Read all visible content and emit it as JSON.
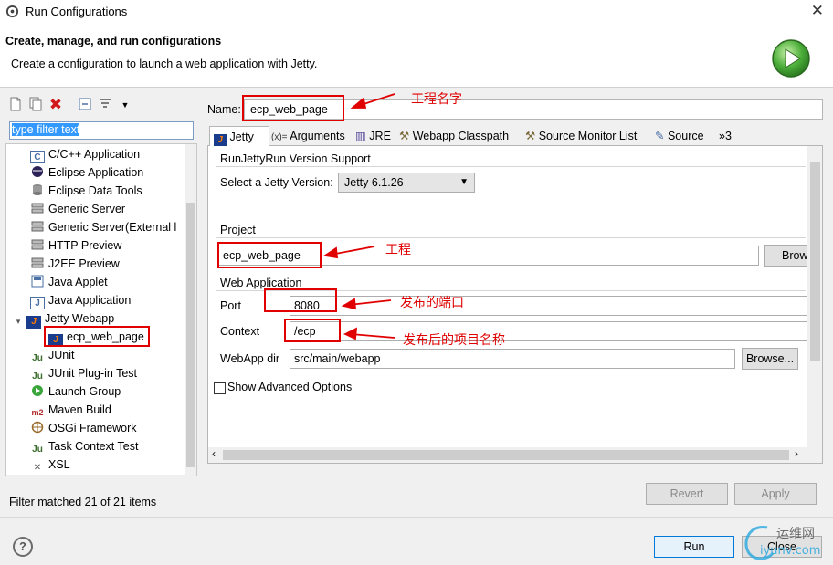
{
  "window": {
    "title": "Run Configurations",
    "close_glyph": "✕"
  },
  "header": {
    "title": "Create, manage, and run configurations",
    "subtitle": "Create a configuration to launch a web application with Jetty."
  },
  "filter": {
    "value": "type filter text"
  },
  "tree": {
    "items": [
      {
        "label": "C/C++ Application",
        "icon": "c-app-icon"
      },
      {
        "label": "Eclipse Application",
        "icon": "eclipse-icon"
      },
      {
        "label": "Eclipse Data Tools",
        "icon": "data-tools-icon"
      },
      {
        "label": "Generic Server",
        "icon": "server-icon"
      },
      {
        "label": "Generic Server(External l",
        "icon": "server-icon"
      },
      {
        "label": "HTTP Preview",
        "icon": "server-icon"
      },
      {
        "label": "J2EE Preview",
        "icon": "server-icon"
      },
      {
        "label": "Java Applet",
        "icon": "applet-icon"
      },
      {
        "label": "Java Application",
        "icon": "java-app-icon"
      },
      {
        "label": "Jetty Webapp",
        "icon": "jetty-icon"
      },
      {
        "label": "ecp_web_page",
        "icon": "jetty-icon"
      },
      {
        "label": "JUnit",
        "icon": "junit-icon"
      },
      {
        "label": "JUnit Plug-in Test",
        "icon": "junit-plugin-icon"
      },
      {
        "label": "Launch Group",
        "icon": "launch-group-icon"
      },
      {
        "label": "Maven Build",
        "icon": "maven-icon"
      },
      {
        "label": "OSGi Framework",
        "icon": "osgi-icon"
      },
      {
        "label": "Task Context Test",
        "icon": "task-icon"
      },
      {
        "label": "XSL",
        "icon": "xsl-icon"
      }
    ],
    "status": "Filter matched 21 of 21 items"
  },
  "config": {
    "name_label": "Name:",
    "name_value": "ecp_web_page",
    "tabs": [
      {
        "label": "Jetty"
      },
      {
        "label": "Arguments",
        "prefix": "(x)="
      },
      {
        "label": "JRE"
      },
      {
        "label": "Webapp Classpath"
      },
      {
        "label": "Source Monitor List"
      },
      {
        "label": "Source"
      },
      {
        "label": "»3"
      }
    ],
    "version_group": "RunJettyRun Version Support",
    "version_label": "Select a Jetty Version:",
    "version_value": "Jetty 6.1.26",
    "project_group": "Project",
    "project_value": "ecp_web_page",
    "project_browse": "Brow",
    "webapp_group": "Web Application",
    "port_label": "Port",
    "port_value": "8080",
    "context_label": "Context",
    "context_value": "/ecp",
    "webappdir_label": "WebApp dir",
    "webappdir_value": "src/main/webapp",
    "browse_label": "Browse...",
    "advanced_label": "Show Advanced Options"
  },
  "annotations": {
    "project_name": "工程名字",
    "project": "工程",
    "port": "发布的端口",
    "context": "发布后的项目名称"
  },
  "buttons": {
    "revert": "Revert",
    "apply": "Apply",
    "run": "Run",
    "close": "Close"
  },
  "watermark": {
    "cn": "运维网",
    "en": "iyunv.com"
  },
  "colors": {
    "accent_red": "#e00000",
    "selection": "#3399ff",
    "run_green": "#3aa53a"
  }
}
